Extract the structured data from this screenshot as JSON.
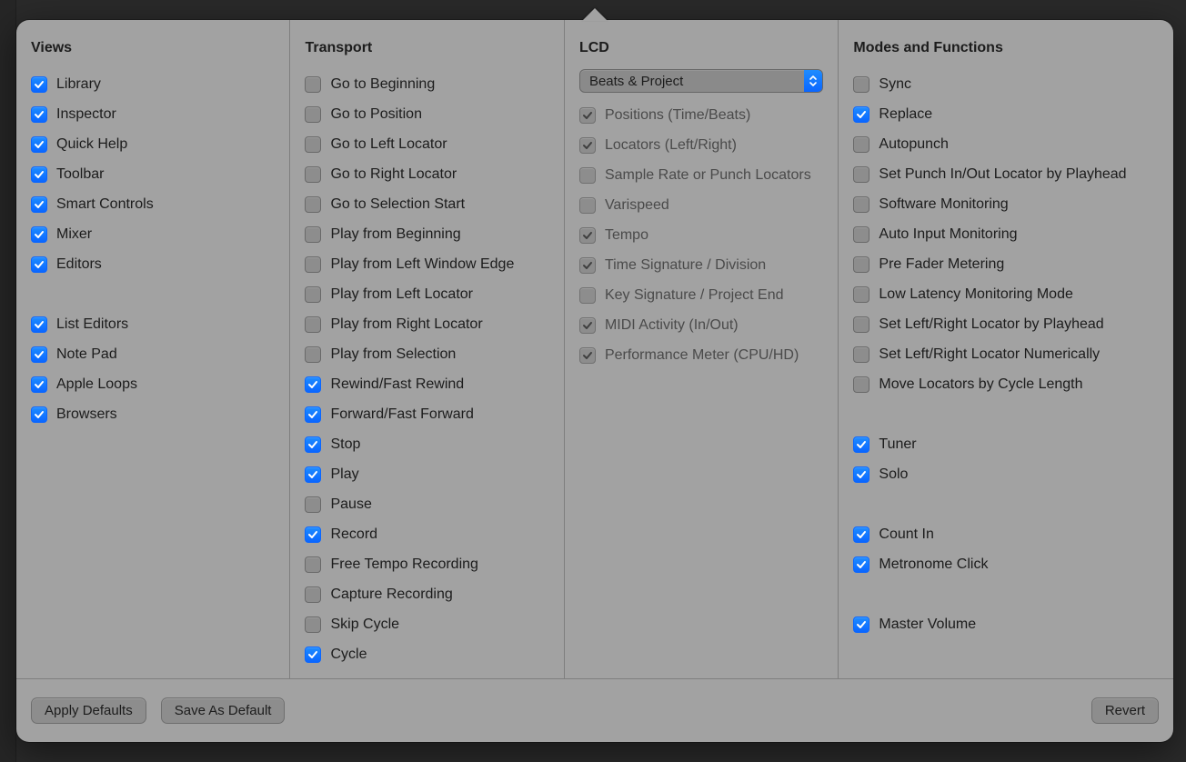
{
  "sections": {
    "views": {
      "title": "Views",
      "items": [
        [
          {
            "label": "Library",
            "checked": true,
            "disabled": false
          },
          {
            "label": "Inspector",
            "checked": true,
            "disabled": false
          },
          {
            "label": "Quick Help",
            "checked": true,
            "disabled": false
          },
          {
            "label": "Toolbar",
            "checked": true,
            "disabled": false
          },
          {
            "label": "Smart Controls",
            "checked": true,
            "disabled": false
          },
          {
            "label": "Mixer",
            "checked": true,
            "disabled": false
          },
          {
            "label": "Editors",
            "checked": true,
            "disabled": false
          }
        ],
        [
          {
            "label": "List Editors",
            "checked": true,
            "disabled": false
          },
          {
            "label": "Note Pad",
            "checked": true,
            "disabled": false
          },
          {
            "label": "Apple Loops",
            "checked": true,
            "disabled": false
          },
          {
            "label": "Browsers",
            "checked": true,
            "disabled": false
          }
        ]
      ]
    },
    "transport": {
      "title": "Transport",
      "items": [
        [
          {
            "label": "Go to Beginning",
            "checked": false,
            "disabled": false
          },
          {
            "label": "Go to Position",
            "checked": false,
            "disabled": false
          },
          {
            "label": "Go to Left Locator",
            "checked": false,
            "disabled": false
          },
          {
            "label": "Go to Right Locator",
            "checked": false,
            "disabled": false
          },
          {
            "label": "Go to Selection Start",
            "checked": false,
            "disabled": false
          },
          {
            "label": "Play from Beginning",
            "checked": false,
            "disabled": false
          },
          {
            "label": "Play from Left Window Edge",
            "checked": false,
            "disabled": false
          },
          {
            "label": "Play from Left Locator",
            "checked": false,
            "disabled": false
          },
          {
            "label": "Play from Right Locator",
            "checked": false,
            "disabled": false
          },
          {
            "label": "Play from Selection",
            "checked": false,
            "disabled": false
          },
          {
            "label": "Rewind/Fast Rewind",
            "checked": true,
            "disabled": false
          },
          {
            "label": "Forward/Fast Forward",
            "checked": true,
            "disabled": false
          },
          {
            "label": "Stop",
            "checked": true,
            "disabled": false
          },
          {
            "label": "Play",
            "checked": true,
            "disabled": false
          },
          {
            "label": "Pause",
            "checked": false,
            "disabled": false
          },
          {
            "label": "Record",
            "checked": true,
            "disabled": false
          },
          {
            "label": "Free Tempo Recording",
            "checked": false,
            "disabled": false
          },
          {
            "label": "Capture Recording",
            "checked": false,
            "disabled": false
          },
          {
            "label": "Skip Cycle",
            "checked": false,
            "disabled": false
          },
          {
            "label": "Cycle",
            "checked": true,
            "disabled": false
          }
        ]
      ]
    },
    "lcd": {
      "title": "LCD",
      "dropdown": {
        "label": "Beats & Project"
      },
      "items": [
        [
          {
            "label": "Positions (Time/Beats)",
            "checked": true,
            "disabled": true
          },
          {
            "label": "Locators (Left/Right)",
            "checked": true,
            "disabled": true
          },
          {
            "label": "Sample Rate or Punch Locators",
            "checked": false,
            "disabled": true
          },
          {
            "label": "Varispeed",
            "checked": false,
            "disabled": true
          },
          {
            "label": "Tempo",
            "checked": true,
            "disabled": true
          },
          {
            "label": "Time Signature / Division",
            "checked": true,
            "disabled": true
          },
          {
            "label": "Key Signature / Project End",
            "checked": false,
            "disabled": true
          },
          {
            "label": "MIDI Activity (In/Out)",
            "checked": true,
            "disabled": true
          },
          {
            "label": "Performance Meter (CPU/HD)",
            "checked": true,
            "disabled": true
          }
        ]
      ]
    },
    "modes": {
      "title": "Modes and Functions",
      "items": [
        [
          {
            "label": "Sync",
            "checked": false,
            "disabled": false
          },
          {
            "label": "Replace",
            "checked": true,
            "disabled": false
          },
          {
            "label": "Autopunch",
            "checked": false,
            "disabled": false
          },
          {
            "label": "Set Punch In/Out Locator by Playhead",
            "checked": false,
            "disabled": false
          },
          {
            "label": "Software Monitoring",
            "checked": false,
            "disabled": false
          },
          {
            "label": "Auto Input Monitoring",
            "checked": false,
            "disabled": false
          },
          {
            "label": "Pre Fader Metering",
            "checked": false,
            "disabled": false
          },
          {
            "label": "Low Latency Monitoring Mode",
            "checked": false,
            "disabled": false
          },
          {
            "label": "Set Left/Right Locator by Playhead",
            "checked": false,
            "disabled": false
          },
          {
            "label": "Set Left/Right Locator Numerically",
            "checked": false,
            "disabled": false
          },
          {
            "label": "Move Locators by Cycle Length",
            "checked": false,
            "disabled": false
          }
        ],
        [
          {
            "label": "Tuner",
            "checked": true,
            "disabled": false
          },
          {
            "label": "Solo",
            "checked": true,
            "disabled": false
          }
        ],
        [
          {
            "label": "Count In",
            "checked": true,
            "disabled": false
          },
          {
            "label": "Metronome Click",
            "checked": true,
            "disabled": false
          }
        ],
        [
          {
            "label": "Master Volume",
            "checked": true,
            "disabled": false
          }
        ]
      ]
    }
  },
  "footer": {
    "apply_defaults": "Apply Defaults",
    "save_as_default": "Save As Default",
    "revert": "Revert"
  }
}
